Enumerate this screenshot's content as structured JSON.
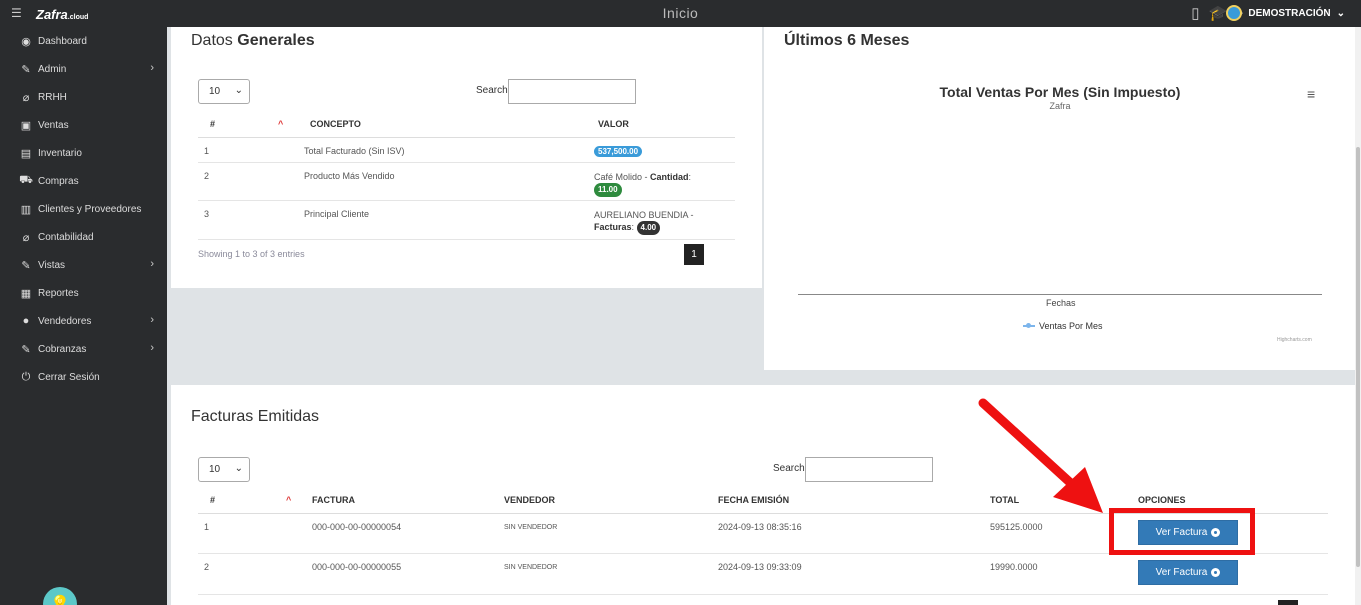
{
  "topbar": {
    "menu_icon": "hamburger-icon",
    "logo": "Zafra",
    "logo_suffix": ".cloud",
    "title": "Inicio",
    "icons": [
      "mobile-icon",
      "graduation-cap-icon",
      "tags-icon"
    ],
    "user": "DEMOSTRACIÓN"
  },
  "sidebar": {
    "items": [
      {
        "label": "Dashboard",
        "icon": "palette-icon",
        "glyph": "◉",
        "chevron": false
      },
      {
        "label": "Admin",
        "icon": "wrench-icon",
        "glyph": "✎",
        "chevron": true
      },
      {
        "label": "RRHH",
        "icon": "paperclip-icon",
        "glyph": "⌀",
        "chevron": false
      },
      {
        "label": "Ventas",
        "icon": "money-icon",
        "glyph": "▣",
        "chevron": false
      },
      {
        "label": "Inventario",
        "icon": "book-icon",
        "glyph": "▤",
        "chevron": false
      },
      {
        "label": "Compras",
        "icon": "cart-icon",
        "glyph": "⛟",
        "chevron": false
      },
      {
        "label": "Clientes y Proveedores",
        "icon": "address-book-icon",
        "glyph": "▥",
        "chevron": false
      },
      {
        "label": "Contabilidad",
        "icon": "paperclip-icon",
        "glyph": "⌀",
        "chevron": false
      },
      {
        "label": "Vistas",
        "icon": "edit-icon",
        "glyph": "✎",
        "chevron": true
      },
      {
        "label": "Reportes",
        "icon": "list-icon",
        "glyph": "▦",
        "chevron": false
      },
      {
        "label": "Vendedores",
        "icon": "user-icon",
        "glyph": "●",
        "chevron": true
      },
      {
        "label": "Cobranzas",
        "icon": "edit-icon",
        "glyph": "✎",
        "chevron": true
      },
      {
        "label": "Cerrar Sesión",
        "icon": "power-icon",
        "glyph": "⏻",
        "chevron": false
      }
    ],
    "help_icon": "lightbulb-icon"
  },
  "datos": {
    "title_a": "Datos",
    "title_b": "Generales",
    "page_size": "10",
    "search_label": "Search:",
    "headers": [
      "#",
      "CONCEPTO",
      "VALOR"
    ],
    "rows": [
      {
        "n": "1",
        "concepto": "Total Facturado (Sin ISV)",
        "valor_badge": "537,500.00"
      },
      {
        "n": "2",
        "concepto": "Producto Más Vendido",
        "valor_text": "Café Molido - ",
        "valor_bold": "Cantidad",
        "valor_badge": "11.00"
      },
      {
        "n": "3",
        "concepto": "Principal Cliente",
        "valor_text": "AURELIANO BUENDIA -",
        "valor_bold": "Facturas",
        "valor_badge": "4.00"
      }
    ],
    "showing": "Showing 1 to 3 of 3 entries",
    "page": "1"
  },
  "meses": {
    "title": "Últimos 6 Meses",
    "chart_menu_icon": "hamburger-icon"
  },
  "chart_data": {
    "type": "line",
    "title": "Total Ventas Por Mes (Sin Impuesto)",
    "subtitle": "Zafra",
    "xlabel": "Fechas",
    "ylabel": "",
    "categories": [],
    "series": [
      {
        "name": "Ventas Por Mes",
        "values": [],
        "color": "#7cb5ec"
      }
    ],
    "credits": "Highcharts.com",
    "legend": "bottom-center"
  },
  "facturas": {
    "title": "Facturas Emitidas",
    "page_size": "10",
    "search_label": "Search:",
    "headers": [
      "#",
      "FACTURA",
      "VENDEDOR",
      "FECHA EMISIÓN",
      "TOTAL",
      "OPCIONES"
    ],
    "rows": [
      {
        "n": "1",
        "factura": "000-000-00-00000054",
        "vendedor": "SIN VENDEDOR",
        "fecha": "2024-09-13 08:35:16",
        "total": "595125.0000",
        "btn": "Ver Factura"
      },
      {
        "n": "2",
        "factura": "000-000-00-00000055",
        "vendedor": "SIN VENDEDOR",
        "fecha": "2024-09-13 09:33:09",
        "total": "19990.0000",
        "btn": "Ver Factura"
      }
    ]
  },
  "annotation": {
    "color": "#ee1111"
  }
}
